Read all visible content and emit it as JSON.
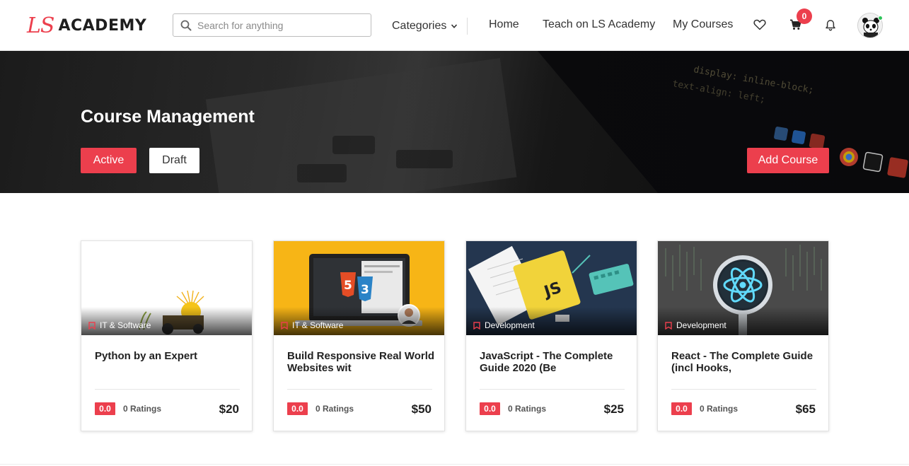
{
  "brand": {
    "mark": "LS",
    "name": "ACADEMY",
    "accent": "#ec3f4d"
  },
  "search": {
    "placeholder": "Search for anything",
    "value": ""
  },
  "nav": {
    "categories": "Categories",
    "home": "Home",
    "teach": "Teach on LS Academy",
    "my_courses": "My Courses"
  },
  "cart": {
    "count": "0"
  },
  "icons": {
    "search": "search-icon",
    "chevron": "chevron-down-icon",
    "wishlist": "heart-icon",
    "cart": "cart-icon",
    "notifications": "bell-icon",
    "avatar": "user-avatar",
    "bookmark": "bookmark-icon"
  },
  "hero": {
    "title": "Course Management",
    "active_label": "Active",
    "draft_label": "Draft",
    "add_label": "Add Course"
  },
  "courses": [
    {
      "category": "IT & Software",
      "title": "Python by an Expert",
      "rating": "0.0",
      "ratings_count": "0 Ratings",
      "price": "$20"
    },
    {
      "category": "IT & Software",
      "title": "Build Responsive Real World Websites wit",
      "rating": "0.0",
      "ratings_count": "0 Ratings",
      "price": "$50"
    },
    {
      "category": "Development",
      "title": "JavaScript - The Complete Guide 2020 (Be",
      "rating": "0.0",
      "ratings_count": "0 Ratings",
      "price": "$25"
    },
    {
      "category": "Development",
      "title": "React - The Complete Guide (incl Hooks,",
      "rating": "0.0",
      "ratings_count": "0 Ratings",
      "price": "$65"
    }
  ]
}
